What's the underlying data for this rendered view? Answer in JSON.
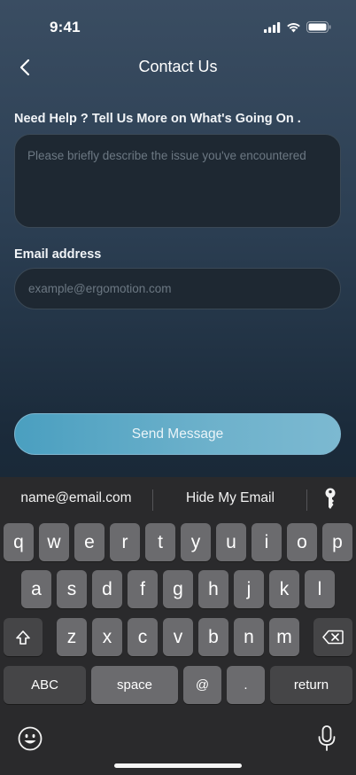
{
  "status": {
    "time": "9:41"
  },
  "nav": {
    "title": "Contact Us"
  },
  "form": {
    "issue_label": "Need Help ? Tell Us More on What's Going On .",
    "issue_placeholder": "Please briefly describe the issue you've encountered",
    "email_label": "Email address",
    "email_placeholder": "example@ergomotion.com",
    "send_label": "Send Message"
  },
  "keyboard": {
    "suggestions": [
      "name@email.com",
      "Hide My Email"
    ],
    "row1": [
      "q",
      "w",
      "e",
      "r",
      "t",
      "y",
      "u",
      "i",
      "o",
      "p"
    ],
    "row2": [
      "a",
      "s",
      "d",
      "f",
      "g",
      "h",
      "j",
      "k",
      "l"
    ],
    "row3": [
      "z",
      "x",
      "c",
      "v",
      "b",
      "n",
      "m"
    ],
    "abc_label": "ABC",
    "space_label": "space",
    "at_label": "@",
    "dot_label": ".",
    "return_label": "return"
  },
  "colors": {
    "accent": "#4a9fc0",
    "field_bg": "#1e2832",
    "keyboard_bg": "#2a2a2c"
  }
}
